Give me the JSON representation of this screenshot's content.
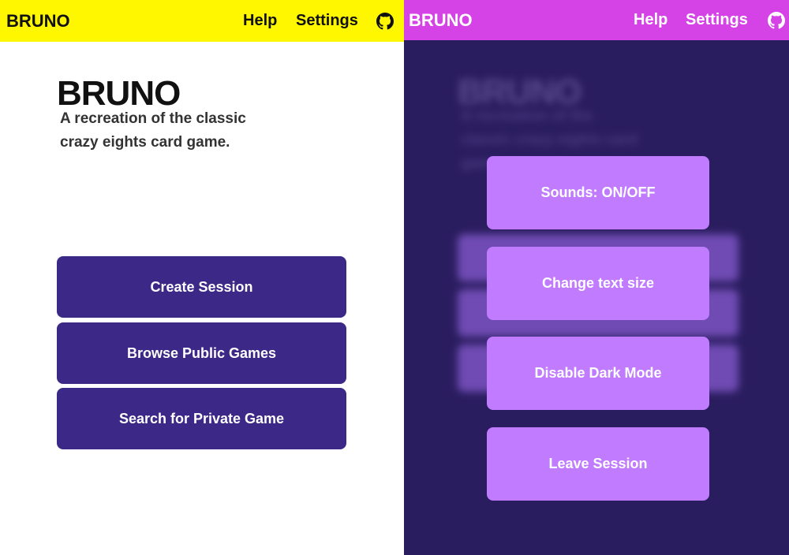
{
  "left": {
    "nav": {
      "brand": "BRUNO",
      "help": "Help",
      "settings": "Settings"
    },
    "hero": {
      "title": "BRUNO",
      "subtitle": "A recreation of the classic crazy eights card game."
    },
    "buttons": {
      "create": "Create Session",
      "browse": "Browse Public Games",
      "search": "Search for Private Game"
    }
  },
  "right": {
    "nav": {
      "brand": "BRUNO",
      "help": "Help",
      "settings": "Settings"
    },
    "background": {
      "title": "BRUNO",
      "subtitle": "A recreation of the classic crazy eights card game."
    },
    "settings_menu": {
      "sounds": "Sounds: ON/OFF",
      "text_size": "Change text size",
      "dark_mode": "Disable Dark Mode",
      "leave": "Leave Session"
    }
  },
  "icons": {
    "github": "github-icon"
  },
  "colors": {
    "left_navbar": "#fff700",
    "right_navbar": "#d543e6",
    "primary_button": "#3c2887",
    "dark_background": "#2a1d5f",
    "modal_button": "#c07bfe"
  }
}
